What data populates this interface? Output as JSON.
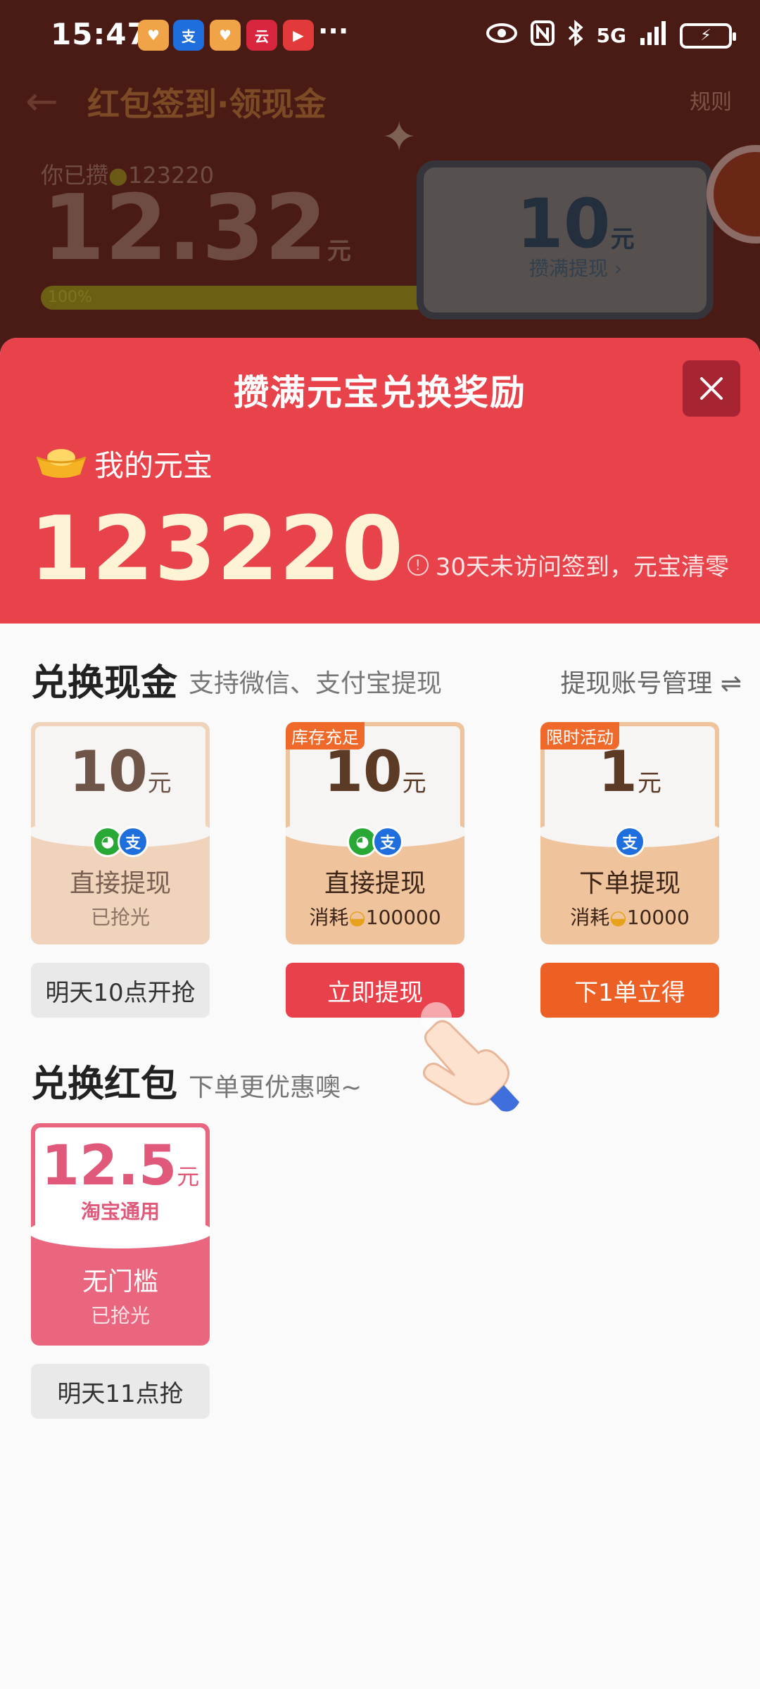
{
  "status_bar": {
    "time": "15:47",
    "apps": [
      {
        "icon": "taobao-app-icon",
        "label": "♥",
        "color": "#f0a347"
      },
      {
        "icon": "alipay-app-icon",
        "label": "支",
        "color": "#1e6fdd"
      },
      {
        "icon": "taobao-app-icon-2",
        "label": "♥",
        "color": "#f0a347"
      },
      {
        "icon": "cloudpay-app-icon",
        "label": "云",
        "color": "#d7263d"
      },
      {
        "icon": "video-app-icon",
        "label": "▶",
        "color": "#e23a3a"
      }
    ],
    "more": "···",
    "network": "5G",
    "battery_icon": "charging"
  },
  "background_page": {
    "title": "红包签到·领现金",
    "rules": "规则",
    "have_text": "你已攒",
    "have_value": "123220",
    "amount": "12.32",
    "amount_unit": "元",
    "progress_label": "100%",
    "card_amount": "10",
    "card_unit": "元",
    "card_action": "攒满提现 ›"
  },
  "modal": {
    "title": "攒满元宝兑换奖励",
    "my_label": "我的元宝",
    "my_value": "123220",
    "notice": "30天未访问签到，元宝清零",
    "cash_section": {
      "title": "兑换现金",
      "subtitle": "支持微信、支付宝提现",
      "account_link": "提现账号管理 ⇌",
      "cards": [
        {
          "badge": "",
          "amount": "10",
          "unit": "元",
          "label": "直接提现",
          "foot": "已抢光",
          "button": "明天10点开抢"
        },
        {
          "badge": "库存充足",
          "amount": "10",
          "unit": "元",
          "label": "直接提现",
          "foot_prefix": "消耗",
          "foot_value": "100000",
          "button": "立即提现"
        },
        {
          "badge": "限时活动",
          "amount": "1",
          "unit": "元",
          "label": "下单提现",
          "foot_prefix": "消耗",
          "foot_value": "10000",
          "button": "下1单立得"
        }
      ]
    },
    "redpack_section": {
      "title": "兑换红包",
      "subtitle": "下单更优惠噢~",
      "card": {
        "amount": "12.5",
        "unit": "元",
        "scope": "淘宝通用",
        "label": "无门槛",
        "foot": "已抢光",
        "button": "明天11点抢"
      }
    }
  },
  "colors": {
    "modal_red": "#e8424b",
    "cta_red": "#e8414b",
    "cta_orange": "#ec5f25",
    "redpack_pink": "#e9667e",
    "wechat_green": "#2aa836",
    "alipay_blue": "#1e6fdd"
  }
}
